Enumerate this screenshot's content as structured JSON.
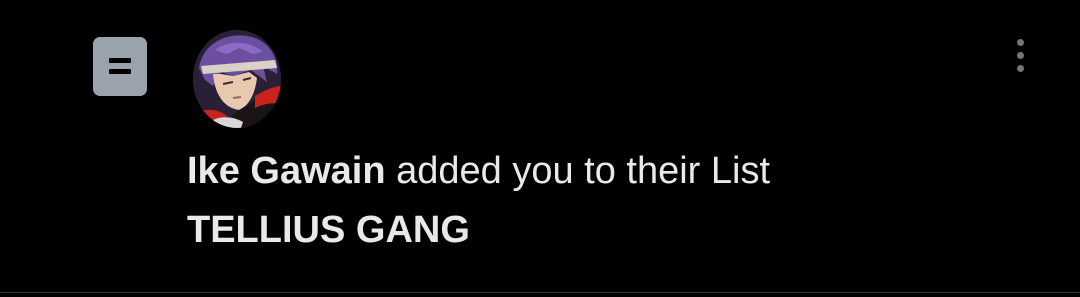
{
  "notification": {
    "type_icon": "list-icon",
    "avatar_icon": "user-avatar",
    "more_icon": "more-vertical-icon",
    "user_name": "Ike Gawain",
    "action_text": " added you to their List",
    "list_name": "TELLIUS GANG"
  },
  "colors": {
    "background": "#000000",
    "text": "#e7e9ea",
    "icon_badge": "#9aa3ab",
    "muted": "#71767b",
    "divider": "#2f3336"
  }
}
